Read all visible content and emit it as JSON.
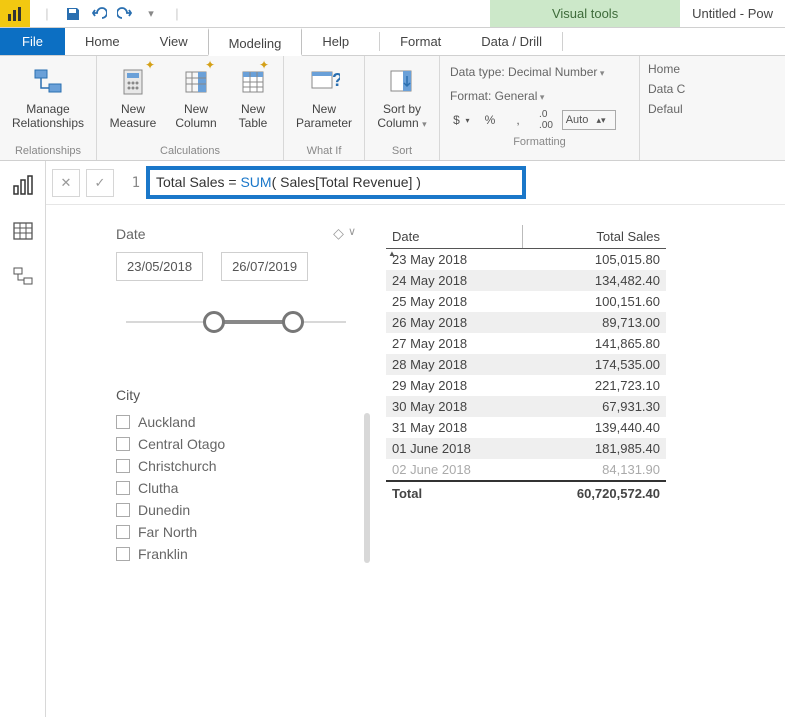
{
  "titlebar": {
    "visual_tools": "Visual tools",
    "doc_name": "Untitled - Pow"
  },
  "tabs": {
    "file": "File",
    "home": "Home",
    "view": "View",
    "modeling": "Modeling",
    "help": "Help",
    "format": "Format",
    "datadrill": "Data / Drill"
  },
  "ribbon": {
    "manage_rel": "Manage\nRelationships",
    "relationships_group": "Relationships",
    "new_measure": "New\nMeasure",
    "new_column": "New\nColumn",
    "new_table": "New\nTable",
    "calc_group": "Calculations",
    "new_parameter": "New\nParameter",
    "whatif_group": "What If",
    "sort_by": "Sort by\nColumn",
    "sort_group": "Sort",
    "datatype_label": "Data type: Decimal Number",
    "format_label": "Format: General",
    "dollar": "$",
    "percent": "%",
    "comma": ",",
    "dec": ".00",
    "auto": "Auto",
    "formatting_group": "Formatting",
    "home_table": "Home ",
    "data_cat": "Data C",
    "default": "Defaul"
  },
  "formula": {
    "lineno": "1",
    "lhs": "Total Sales = ",
    "fn": "SUM",
    "args": "( Sales[Total Revenue] )"
  },
  "slicer": {
    "date_label": "Date",
    "start": "23/05/2018",
    "end": "26/07/2019",
    "city_label": "City",
    "cities": [
      "Auckland",
      "Central Otago",
      "Christchurch",
      "Clutha",
      "Dunedin",
      "Far North",
      "Franklin"
    ]
  },
  "table": {
    "col_date": "Date",
    "col_total": "Total Sales",
    "rows": [
      {
        "d": "23 May 2018",
        "v": "105,015.80"
      },
      {
        "d": "24 May 2018",
        "v": "134,482.40"
      },
      {
        "d": "25 May 2018",
        "v": "100,151.60"
      },
      {
        "d": "26 May 2018",
        "v": "89,713.00"
      },
      {
        "d": "27 May 2018",
        "v": "141,865.80"
      },
      {
        "d": "28 May 2018",
        "v": "174,535.00"
      },
      {
        "d": "29 May 2018",
        "v": "221,723.10"
      },
      {
        "d": "30 May 2018",
        "v": "67,931.30"
      },
      {
        "d": "31 May 2018",
        "v": "139,440.40"
      },
      {
        "d": "01 June 2018",
        "v": "181,985.40"
      },
      {
        "d": "02 June 2018",
        "v": "84,131.90"
      }
    ],
    "total_label": "Total",
    "total_value": "60,720,572.40"
  }
}
